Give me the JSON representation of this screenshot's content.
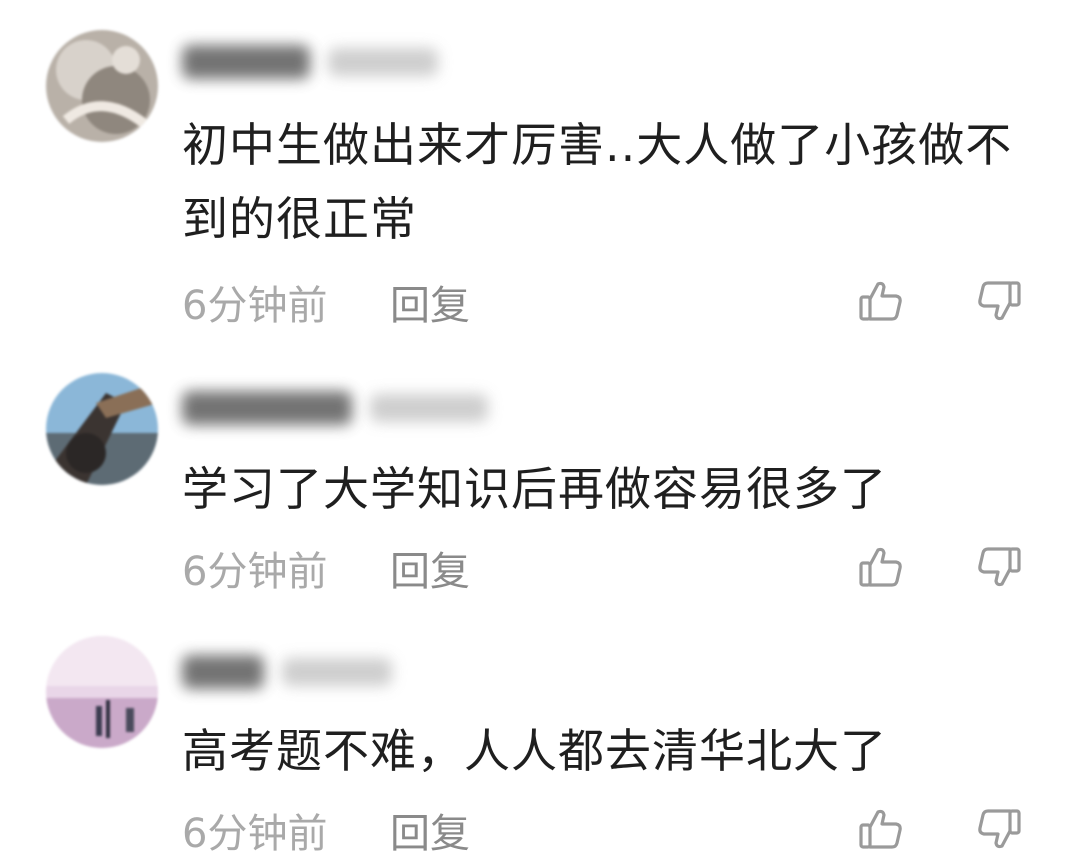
{
  "comments": [
    {
      "text": "初中生做出来才厉害..大人做了小孩做不到的很正常",
      "time": "6分钟前",
      "reply_label": "回复",
      "avatar_icon": "user-avatar-blurred",
      "like_icon": "thumbs-up-icon",
      "dislike_icon": "thumbs-down-icon"
    },
    {
      "text": "学习了大学知识后再做容易很多了",
      "time": "6分钟前",
      "reply_label": "回复",
      "avatar_icon": "user-avatar-blurred",
      "like_icon": "thumbs-up-icon",
      "dislike_icon": "thumbs-down-icon"
    },
    {
      "text": "高考题不难，人人都去清华北大了",
      "time": "6分钟前",
      "reply_label": "回复",
      "avatar_icon": "user-avatar-blurred",
      "like_icon": "thumbs-up-icon",
      "dislike_icon": "thumbs-down-icon"
    }
  ],
  "colors": {
    "text": "#1f1f1f",
    "meta": "#a9a9a9",
    "reply": "#8a8a8a",
    "icon": "#9a9a9a"
  }
}
